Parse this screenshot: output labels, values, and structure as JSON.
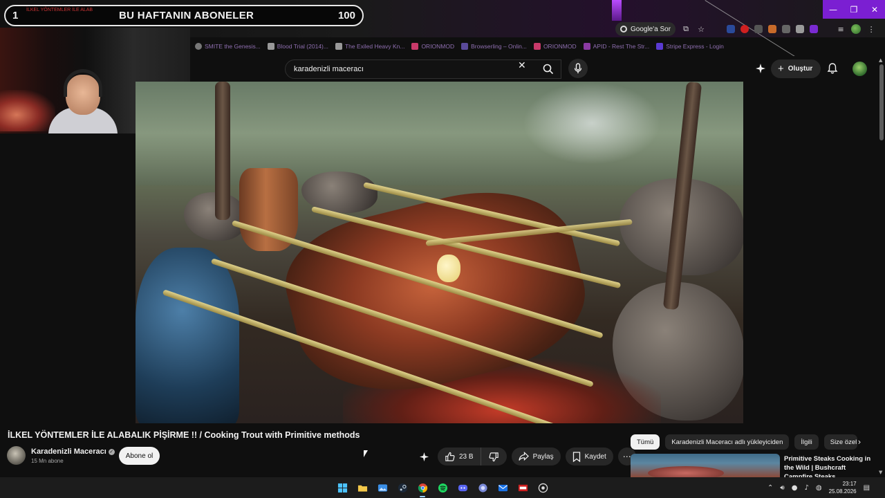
{
  "overlay": {
    "subs_rank": "1",
    "subs_title": "BU HAFTANIN ABONELER",
    "subs_count": "100",
    "ticker_text": "İLKEL YÖNTEMLER İLE ALAB"
  },
  "browser": {
    "google_sor_label": "Google'a Sor",
    "window_controls": [
      "—",
      "❐",
      "✕"
    ],
    "bookmarks": [
      {
        "label": "SMITE the Genesis..."
      },
      {
        "label": "Blood Trial (2014)..."
      },
      {
        "label": "The Exiled Heavy Kn..."
      },
      {
        "label": "ORIONMOD"
      },
      {
        "label": "Browserling – Onlin..."
      },
      {
        "label": "ORIONMOD"
      },
      {
        "label": "APID - Rest The Str..."
      },
      {
        "label": "Stripe Express - Login"
      }
    ],
    "accent_color": "#7b1fd2"
  },
  "search": {
    "query": "karadenizli maceracı",
    "clear_icon": "✕"
  },
  "masthead": {
    "create_label": "Oluştur"
  },
  "video": {
    "title": "İLKEL YÖNTEMLER İLE ALABALIK PİŞİRME !! / Cooking Trout with Primitive methods",
    "channel_name": "Karadenizli Maceracı",
    "channel_subs": "15 Mn abone",
    "subscribe_label": "Abone ol",
    "like_count": "23 B",
    "share_label": "Paylaş",
    "save_label": "Kaydet",
    "more_label": "⋯"
  },
  "chips": [
    "Tümü",
    "Karadenizli Maceracı adlı yükleyiciden",
    "İlgili",
    "Size özel"
  ],
  "recommendation": {
    "title": "Primitive Steaks Cooking in the Wild | Bushcraft Campfire Steaks Compilation"
  },
  "taskbar": {
    "time": "23:17",
    "date": "25.08.2026"
  }
}
